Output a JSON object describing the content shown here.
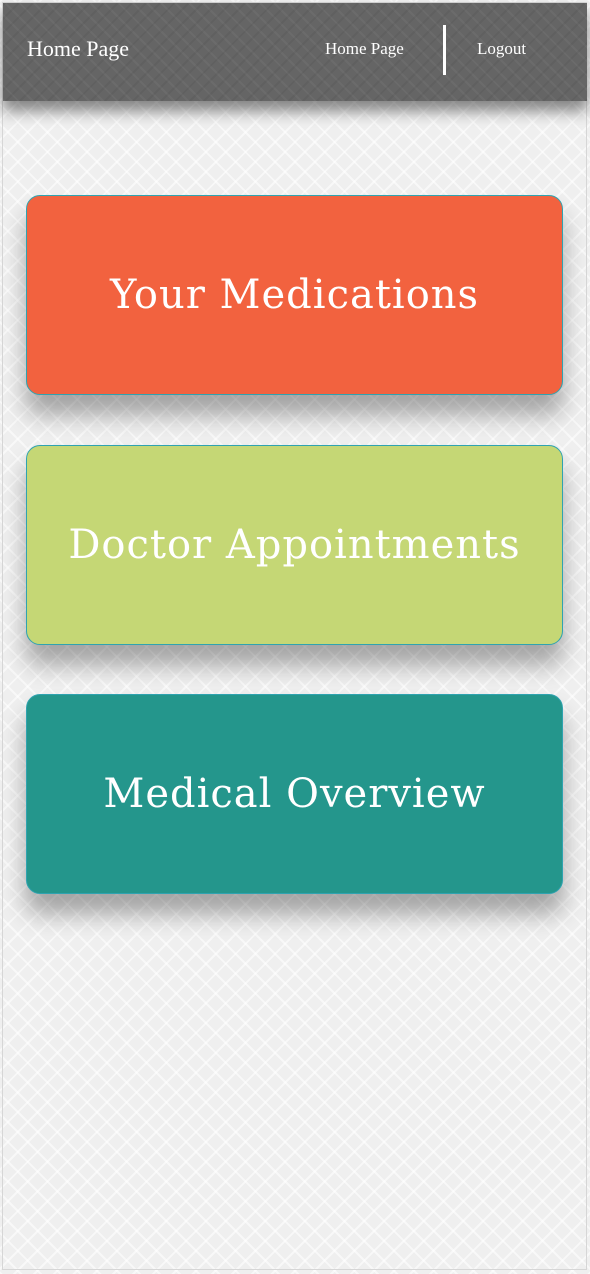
{
  "navbar": {
    "brand": "Home Page",
    "links": {
      "home": "Home Page",
      "logout": "Logout"
    },
    "background_color": "#656565"
  },
  "cards": [
    {
      "label": "Your Medications",
      "color": "#f2623f"
    },
    {
      "label": "Doctor Appointments",
      "color": "#c5d775"
    },
    {
      "label": "Medical Overview",
      "color": "#24968c"
    }
  ],
  "card_border_color": "#2fa3b0",
  "page_background_color": "#efefef"
}
